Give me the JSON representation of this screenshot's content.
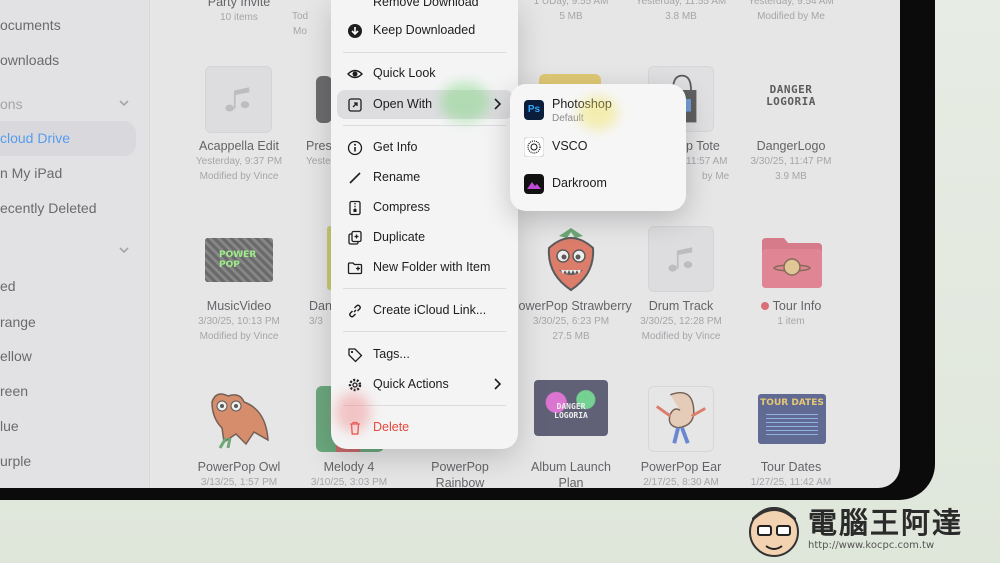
{
  "sidebar": {
    "items": [
      {
        "label": "ocuments"
      },
      {
        "label": "ownloads"
      },
      {
        "label": "ons"
      },
      {
        "label": "cloud Drive"
      },
      {
        "label": "n My iPad"
      },
      {
        "label": "ecently Deleted"
      },
      {
        "label": "ed"
      },
      {
        "label": "range"
      },
      {
        "label": "ellow"
      },
      {
        "label": "reen"
      },
      {
        "label": "lue"
      },
      {
        "label": "urple"
      }
    ]
  },
  "files": {
    "top_row": [
      {
        "name": "Party Invite",
        "meta1": "10 items"
      },
      {
        "name": "",
        "meta1": "Tod",
        "meta2": "Mo"
      },
      {
        "name": "",
        "meta1": "1 UDay, 9:55 AM",
        "meta2": "5 MB"
      },
      {
        "name": "",
        "meta1": "Yesterday, 11:55 AM",
        "meta2": "3.8 MB"
      },
      {
        "name": "",
        "meta1": "Yesterday, 9:54 AM",
        "meta2": "Modified by Me"
      }
    ],
    "row1": [
      {
        "name": "Acappella Edit",
        "meta1": "Yesterday, 9:37 PM",
        "meta2": "Modified by Vince"
      },
      {
        "name": "Pres",
        "meta1": "Yeste"
      },
      {
        "name": "p Tote",
        "meta1": "11:57 AM",
        "meta2": "by Me"
      },
      {
        "name": "DangerLogo",
        "meta1": "3/30/25, 11:47 PM",
        "meta2": "3.9 MB"
      }
    ],
    "row2": [
      {
        "name": "MusicVideo",
        "meta1": "3/30/25, 10:13 PM",
        "meta2": "Modified by Vince"
      },
      {
        "name": "Dan",
        "meta1": "3/3"
      },
      {
        "name": "PowerPop Strawberry",
        "meta1": "3/30/25, 6:23 PM",
        "meta2": "27.5 MB"
      },
      {
        "name": "Drum Track",
        "meta1": "3/30/25, 12:28 PM",
        "meta2": "Modified by Vince"
      },
      {
        "name": "Tour Info",
        "meta1": "1 item"
      }
    ],
    "row3": [
      {
        "name": "PowerPop Owl",
        "meta1": "3/13/25, 1:57 PM"
      },
      {
        "name": "Melody 4",
        "meta1": "3/10/25, 3:03 PM"
      },
      {
        "name": "PowerPop Rainbow"
      },
      {
        "name": "Album Launch Plan"
      },
      {
        "name": "PowerPop Ear",
        "meta1": "2/17/25, 8:30 AM"
      },
      {
        "name": "Tour Dates",
        "meta1": "1/27/25, 11:42 AM"
      }
    ]
  },
  "thumb_text": {
    "danger_logo": "DANGER LOGORIA",
    "music_video": "POWER POP",
    "album": "DANGER LOGORIA",
    "tour": "TOUR DATES"
  },
  "context_menu": {
    "remove_download": "Remove Download",
    "keep_downloaded": "Keep Downloaded",
    "quick_look": "Quick Look",
    "open_with": "Open With",
    "get_info": "Get Info",
    "rename": "Rename",
    "compress": "Compress",
    "duplicate": "Duplicate",
    "new_folder_with_item": "New Folder with Item",
    "create_icloud_link": "Create iCloud Link...",
    "tags": "Tags...",
    "quick_actions": "Quick Actions",
    "delete": "Delete"
  },
  "open_with_submenu": {
    "photoshop": "Photoshop",
    "photoshop_sub": "Default",
    "photoshop_badge": "Ps",
    "vsco": "VSCO",
    "darkroom": "Darkroom"
  },
  "watermark": {
    "title": "電腦王阿達",
    "url": "http://www.kocpc.com.tw"
  },
  "colors": {
    "accent": "#0a7aff",
    "delete": "#e5473b",
    "tag_red": "#e0323c"
  }
}
